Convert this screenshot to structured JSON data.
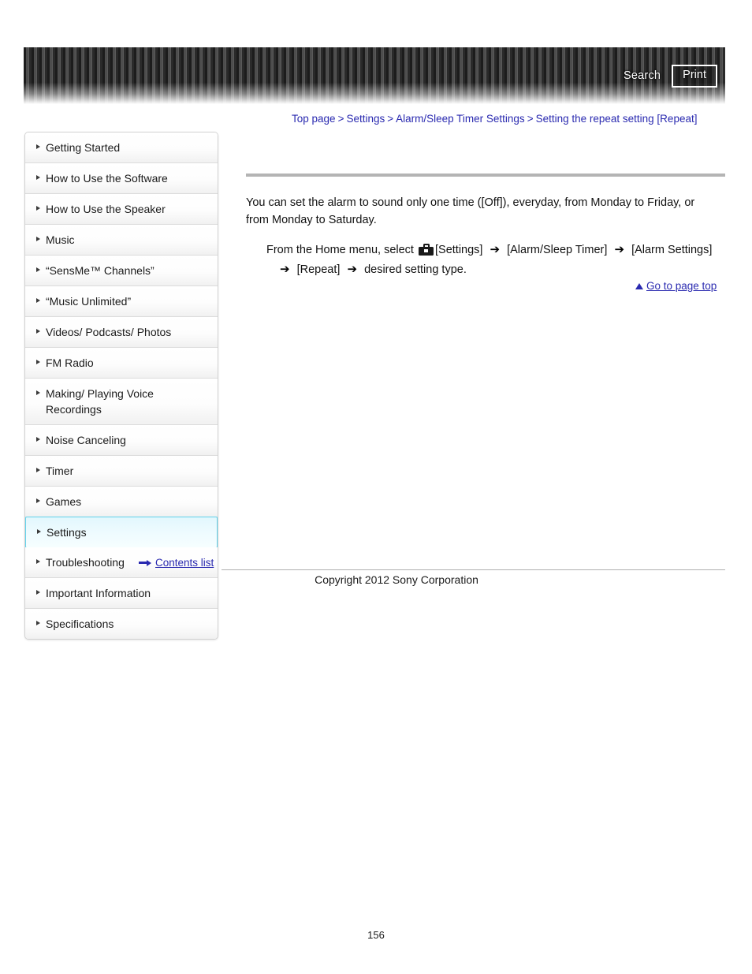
{
  "header": {
    "search_label": "Search",
    "print_label": "Print"
  },
  "breadcrumb": {
    "separator": ">",
    "items": [
      {
        "label": "Top page"
      },
      {
        "label": "Settings"
      },
      {
        "label": "Alarm/Sleep Timer Settings"
      },
      {
        "label": "Setting the repeat setting [Repeat]"
      }
    ]
  },
  "sidebar": {
    "items": [
      {
        "label": "Getting Started",
        "active": false
      },
      {
        "label": "How to Use the Software",
        "active": false
      },
      {
        "label": "How to Use the Speaker",
        "active": false
      },
      {
        "label": "Music",
        "active": false
      },
      {
        "label": "“SensMe™ Channels”",
        "active": false
      },
      {
        "label": "“Music Unlimited”",
        "active": false
      },
      {
        "label": "Videos/ Podcasts/ Photos",
        "active": false
      },
      {
        "label": "FM Radio",
        "active": false
      },
      {
        "label": "Making/ Playing Voice Recordings",
        "active": false
      },
      {
        "label": "Noise Canceling",
        "active": false
      },
      {
        "label": "Timer",
        "active": false
      },
      {
        "label": "Games",
        "active": false
      },
      {
        "label": "Settings",
        "active": true
      },
      {
        "label": "Troubleshooting",
        "active": false
      },
      {
        "label": "Important Information",
        "active": false
      },
      {
        "label": "Specifications",
        "active": false
      }
    ]
  },
  "main": {
    "intro": "You can set the alarm to sound only one time ([Off]), everyday, from Monday to Friday, or from Monday to Saturday.",
    "steps": {
      "lead": "From the Home menu, select",
      "settings_label": "[Settings]",
      "arrow": "➔",
      "step_alarm_sleep_timer": "[Alarm/Sleep Timer]",
      "step_alarm_settings": "[Alarm Settings]",
      "step_repeat": "[Repeat]",
      "step_final": "desired setting type."
    },
    "goto_top_label": "Go to page top"
  },
  "footer": {
    "contents_list_label": "Contents list",
    "copyright": "Copyright 2012 Sony Corporation",
    "page_number": "156"
  },
  "colors": {
    "link": "#2a2ab0",
    "active_border": "#63d3ec",
    "active_bg": "#e2f7fd",
    "rule": "#b4b4b4"
  }
}
